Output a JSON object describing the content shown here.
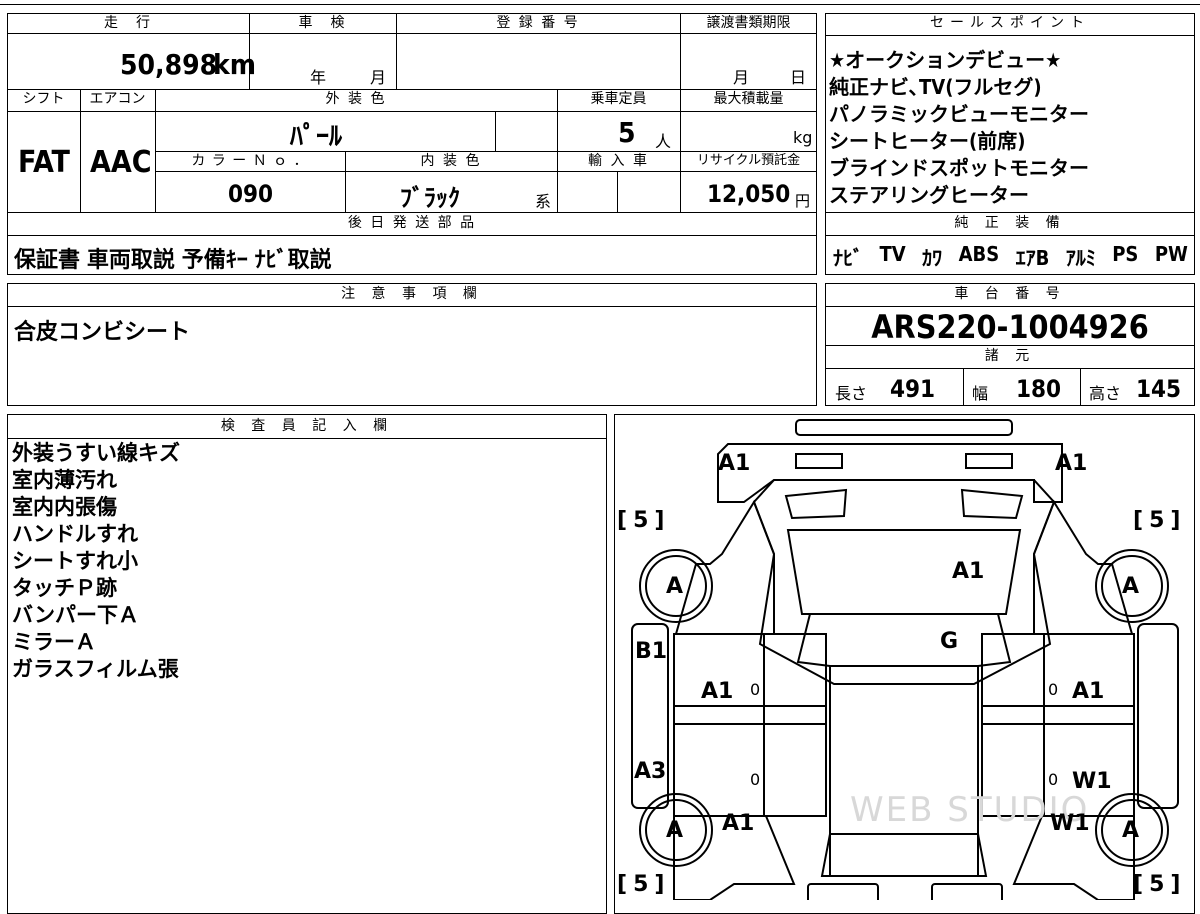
{
  "top_form": {
    "mileage_label": "走　行",
    "mileage_value": "50,898",
    "mileage_unit": "km",
    "inspection_label": "車　検",
    "year_label": "年",
    "month_label": "月",
    "registration_label": "登 録 番 号",
    "transfer_deadline_label": "譲渡書類期限",
    "transfer_month_label": "月",
    "transfer_day_label": "日",
    "shift_label": "シフト",
    "shift_value": "FAT",
    "ac_label": "エアコン",
    "ac_value": "AAC",
    "exterior_color_label": "外 装 色",
    "exterior_color_value": "ﾊﾟｰﾙ",
    "seating_label": "乗車定員",
    "seating_value": "5",
    "seating_unit": "人",
    "max_load_label": "最大積載量",
    "max_load_unit": "kg",
    "color_no_label": "カ ラ ー Ｎ ｏ ．",
    "color_no_value": "090",
    "interior_color_label": "内 装 色",
    "interior_color_value": "ﾌﾞﾗｯｸ",
    "interior_color_suffix": "系",
    "import_label": "輸 入 車",
    "recycle_label": "リサイクル預託金",
    "recycle_value": "12,050",
    "recycle_unit": "円",
    "later_parts_label": "後 日 発 送 部 品",
    "later_parts_value": "保証書 車両取説 予備ｷｰ ﾅﾋﾞ取説"
  },
  "sales_points": {
    "label": "セールスポイント",
    "items": [
      "★オークションデビュー★",
      "純正ナビ､TV(フルセグ)",
      "パノラミックビューモニター",
      "シートヒーター(前席)",
      "ブラインドスポットモニター",
      "ステアリングヒーター"
    ]
  },
  "standard_equipment": {
    "label": "純 正 装 備",
    "items": [
      "ﾅﾋﾞ",
      "TV",
      "ｶﾜ",
      "ABS",
      "ｴｱB",
      "ｱﾙﾐ",
      "PS",
      "PW"
    ]
  },
  "notes": {
    "label": "注 意 事 項 欄",
    "value": "合皮コンビシート"
  },
  "chassis": {
    "label": "車 台 番 号",
    "value": "ARS220-1004926"
  },
  "specs": {
    "label": "諸 元",
    "length_label": "長さ",
    "length_value": "491",
    "width_label": "幅",
    "width_value": "180",
    "height_label": "高さ",
    "height_value": "145"
  },
  "inspector": {
    "label": "検 査 員 記 入 欄",
    "lines": [
      "外装うすい線キズ",
      "室内薄汚れ",
      "室内内張傷",
      "ハンドルすれ",
      "シートすれ小",
      "タッチＰ跡",
      "バンパー下Ａ",
      "ミラーＡ",
      "ガラスフィルム張"
    ]
  },
  "damage_map": {
    "marks": {
      "front_left": "A1",
      "front_right": "A1",
      "hood": "A1",
      "windshield": "G",
      "left_front_fender": "B1",
      "left_front_door": "A1",
      "right_front_door": "A1",
      "left_rear_panel": "A3",
      "right_rear_door": "W1",
      "left_rear_fender": "A1",
      "right_rear_fender": "W1",
      "tire_front_left": "A",
      "tire_front_right": "A",
      "tire_rear_left": "A",
      "tire_rear_right": "A",
      "tread_front_left": "5",
      "tread_front_right": "5",
      "tread_rear_left": "5",
      "tread_rear_right": "5",
      "door_zero_1": "0",
      "door_zero_2": "0",
      "door_zero_3": "0",
      "door_zero_4": "0"
    },
    "watermark": "WEB STUDIO"
  }
}
